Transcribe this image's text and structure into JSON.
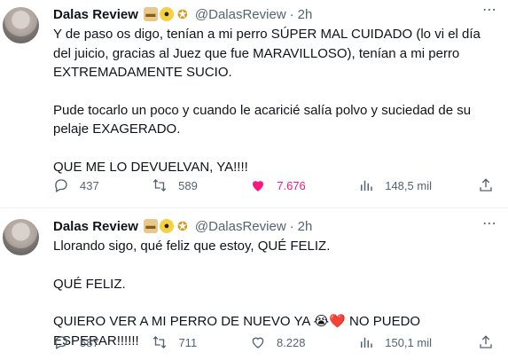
{
  "tweets": [
    {
      "author": {
        "name": "Dalas Review",
        "handle": "@DalasReview",
        "time": "2h",
        "badges": [
          "bread-badge",
          "bee-badge",
          "medal-badge"
        ]
      },
      "paragraphs": [
        "Y de paso os digo, tenían a mi perro SÚPER MAL CUIDADO (lo vi el día del juicio, gracias al Juez que fue MARAVILLOSO), tenían a mi perro EXTREMADAMENTE SUCIO.",
        "Pude tocarlo un poco y cuando le acaricié salía polvo y suciedad de su pelaje EXAGERADO.",
        "QUE ME LO DEVUELVAN, YA!!!!"
      ],
      "stats": {
        "replies": "437",
        "retweets": "589",
        "likes": "7.676",
        "views": "148,5 mil"
      },
      "liked": true
    },
    {
      "author": {
        "name": "Dalas Review",
        "handle": "@DalasReview",
        "time": "2h",
        "badges": [
          "bread-badge",
          "bee-badge",
          "medal-badge"
        ]
      },
      "paragraphs": [
        "Llorando sigo, qué feliz que estoy, QUÉ FELIZ.",
        "QUÉ FELIZ.",
        "QUIERO VER A MI PERRO DE NUEVO YA 😭❤️ NO PUEDO ESPERAR!!!!!!"
      ],
      "stats": {
        "replies": "587",
        "retweets": "711",
        "likes": "8.228",
        "views": "150,1 mil"
      },
      "liked": false
    }
  ],
  "more_icon": "⋯",
  "colors": {
    "text": "#0f1419",
    "muted": "#536471",
    "like": "#f91880",
    "divider": "#eff3f4"
  }
}
